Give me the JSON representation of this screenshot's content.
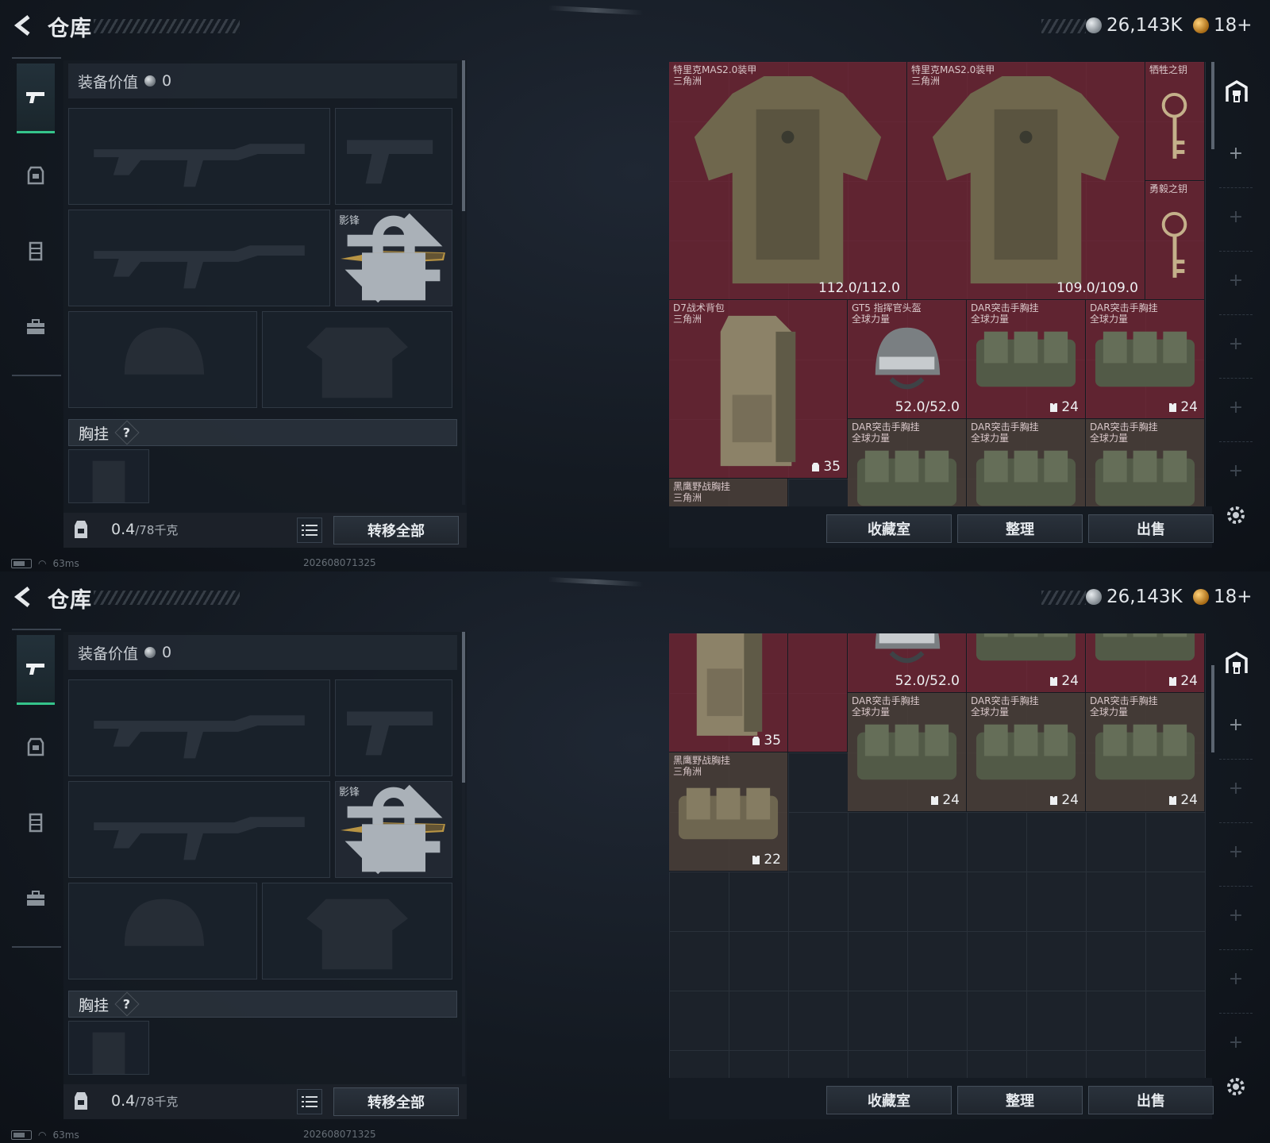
{
  "header": {
    "title": "仓库"
  },
  "currency": {
    "coins": "26,143K",
    "tickets": "18+"
  },
  "loadout": {
    "value_label": "装备价值",
    "value": "0",
    "melee_name": "影锋",
    "vest_label": "胸挂",
    "vest_help": "?",
    "weight_current": "0.4",
    "weight_max": "/78千克",
    "transfer_all": "转移全部"
  },
  "status": {
    "ping": "63ms",
    "build": "202608071325"
  },
  "stash_items": {
    "armor1": {
      "name": "特里克MAS2.0装甲",
      "region": "三角洲",
      "durability": "112.0/112.0"
    },
    "armor2": {
      "name": "特里克MAS2.0装甲",
      "region": "三角洲",
      "durability": "109.0/109.0"
    },
    "key1": {
      "name": "牺牲之钥"
    },
    "key2": {
      "name": "勇毅之钥"
    },
    "backpack": {
      "name": "D7战术背包",
      "region": "三角洲",
      "capacity": "35"
    },
    "helmet": {
      "name": "GT5 指挥官头盔",
      "region": "全球力量",
      "durability": "52.0/52.0"
    },
    "dar_rig": {
      "name": "DAR突击手胸挂",
      "region": "全球力量",
      "capacity": "24"
    },
    "hawk_rig": {
      "name": "黑鹰野战胸挂",
      "region": "三角洲",
      "capacity": "22"
    }
  },
  "stash_buttons": {
    "collection": "收藏室",
    "sort": "整理",
    "sell": "出售"
  },
  "colors": {
    "accent_green": "#35c48b",
    "item_red": "#7c2634",
    "panel": "#161c24"
  }
}
